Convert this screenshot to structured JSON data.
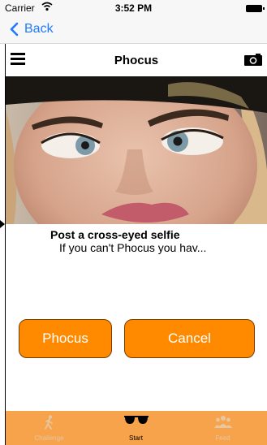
{
  "status_bar": {
    "carrier": "Carrier",
    "wifi_icon": "wifi-icon",
    "time": "3:52 PM",
    "battery_icon": "battery-icon"
  },
  "nav": {
    "back_label": "Back",
    "back_icon": "chevron-left-icon"
  },
  "header": {
    "title": "Phocus",
    "menu_icon": "hamburger-menu-icon",
    "camera_icon": "camera-icon"
  },
  "post": {
    "title": "Post a cross-eyed selfie",
    "subtitle": "If you can't Phocus you hav..."
  },
  "buttons": {
    "primary_label": "Phocus",
    "cancel_label": "Cancel"
  },
  "tabs": [
    {
      "label": "Challenge",
      "icon": "walking-person-icon",
      "active": false
    },
    {
      "label": "Start",
      "icon": "sunglasses-icon",
      "active": true
    },
    {
      "label": "Feed",
      "icon": "people-group-icon",
      "active": false
    }
  ],
  "colors": {
    "accent_blue": "#1f7aff",
    "button_orange": "#ff8a00",
    "tab_bar_orange": "#f7a34c"
  }
}
